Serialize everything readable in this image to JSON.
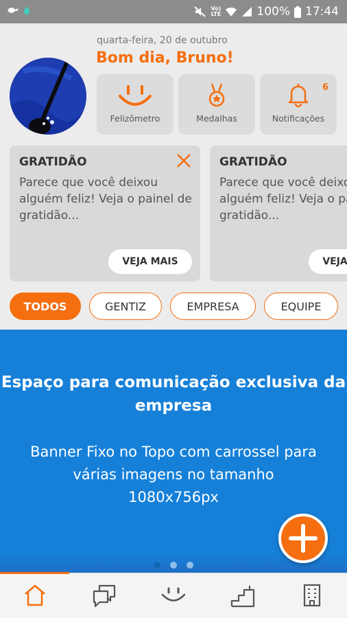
{
  "status_bar": {
    "battery": "100%",
    "time": "17:44",
    "network": "LTE"
  },
  "header": {
    "date": "quarta-feira, 20 de outubro",
    "greeting": "Bom dia, Bruno!",
    "tiles": [
      {
        "label": "Felizômetro",
        "icon": "smile-icon"
      },
      {
        "label": "Medalhas",
        "icon": "medal-icon"
      },
      {
        "label": "Notificações",
        "icon": "bell-icon",
        "count": "6"
      }
    ]
  },
  "cards": [
    {
      "title": "GRATIDÃO",
      "body": "Parece que você deixou alguém feliz! Veja o painel de gratidão...",
      "button": "VEJA MAIS"
    },
    {
      "title": "GRATIDÃO",
      "body": "Parece que você deixou alguém feliz! Veja o painel de gratidão...",
      "button": "VEJA MAIS"
    }
  ],
  "filters": [
    {
      "label": "TODOS",
      "active": true
    },
    {
      "label": "GENTIZ",
      "active": false
    },
    {
      "label": "EMPRESA",
      "active": false
    },
    {
      "label": "EQUIPE",
      "active": false
    }
  ],
  "banner": {
    "title": "Espaço para comunicação exclusiva da empresa",
    "body": "Banner Fixo no Topo com carrossel para várias imagens no tamanho 1080x756px",
    "slides": 3,
    "active_slide": 1
  },
  "bottom_nav": [
    {
      "icon": "home-icon",
      "active": true
    },
    {
      "icon": "chat-icon",
      "active": false
    },
    {
      "icon": "smile-icon",
      "active": false
    },
    {
      "icon": "podium-icon",
      "active": false
    },
    {
      "icon": "building-icon",
      "active": false
    }
  ],
  "colors": {
    "accent": "#f56e0f",
    "banner": "#1680d9",
    "background": "#ececec"
  }
}
